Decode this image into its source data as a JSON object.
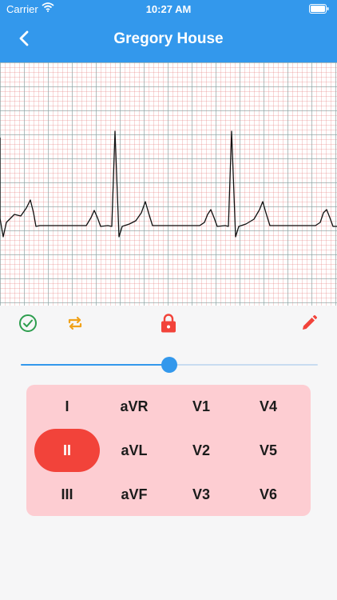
{
  "status_bar": {
    "carrier": "Carrier",
    "time": "10:27 AM"
  },
  "header": {
    "title": "Gregory House",
    "back_icon": "chevron-left-icon"
  },
  "colors": {
    "header": "#3398ec",
    "check": "#2e9e4f",
    "repeat": "#f0a21a",
    "lock": "#f2433a",
    "pencil": "#f2433a",
    "lead_panel": "#fdcdd2",
    "lead_active": "#f2433a"
  },
  "toolbar": {
    "icons": [
      "check-circle-icon",
      "repeat-icon",
      "lock-icon",
      "pencil-icon"
    ]
  },
  "slider": {
    "value_fraction": 0.5
  },
  "leads": {
    "selected": "II",
    "items": [
      "I",
      "aVR",
      "V1",
      "V4",
      "II",
      "aVL",
      "V2",
      "V5",
      "III",
      "aVF",
      "V3",
      "V6"
    ]
  }
}
